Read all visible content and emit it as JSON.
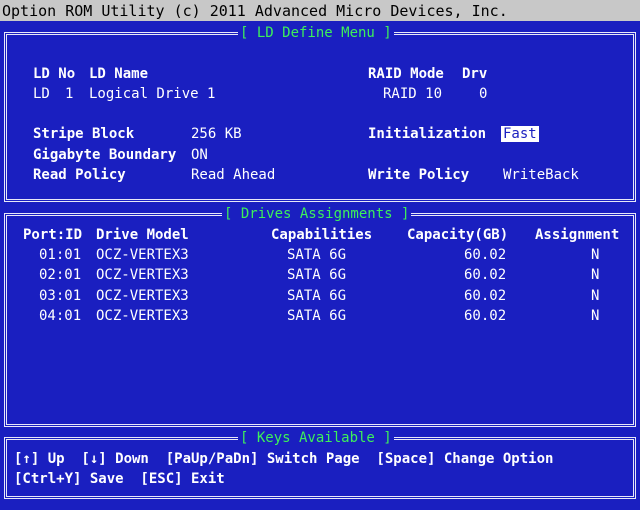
{
  "title_bar": "Option ROM Utility (c) 2011 Advanced Micro Devices, Inc.",
  "ld_menu": {
    "title": "[ LD Define Menu ]",
    "headers": {
      "ld_no": "LD No",
      "ld_name": "LD Name",
      "raid_mode": "RAID Mode",
      "drv": "Drv"
    },
    "row": {
      "ld": "LD",
      "no": "1",
      "name": "Logical Drive 1",
      "raid_mode": "RAID 10",
      "drv": "0"
    },
    "stripe_block_label": "Stripe Block",
    "stripe_block_value": "256 KB",
    "gigabyte_boundary_label": "Gigabyte Boundary",
    "gigabyte_boundary_value": "ON",
    "read_policy_label": "Read Policy",
    "read_policy_value": "Read Ahead",
    "initialization_label": "Initialization",
    "initialization_value": "Fast",
    "write_policy_label": "Write Policy",
    "write_policy_value": "WriteBack"
  },
  "drives": {
    "title": "[ Drives Assignments ]",
    "headers": {
      "port": "Port:ID",
      "model": "Drive Model",
      "caps": "Capabilities",
      "capacity": "Capacity(GB)",
      "assign": "Assignment"
    },
    "rows": [
      {
        "port": "01:01",
        "model": "OCZ-VERTEX3",
        "caps": "SATA 6G",
        "capacity": "60.02",
        "assign": "N"
      },
      {
        "port": "02:01",
        "model": "OCZ-VERTEX3",
        "caps": "SATA 6G",
        "capacity": "60.02",
        "assign": "N"
      },
      {
        "port": "03:01",
        "model": "OCZ-VERTEX3",
        "caps": "SATA 6G",
        "capacity": "60.02",
        "assign": "N"
      },
      {
        "port": "04:01",
        "model": "OCZ-VERTEX3",
        "caps": "SATA 6G",
        "capacity": "60.02",
        "assign": "N"
      }
    ]
  },
  "keys": {
    "title": "[ Keys Available ]",
    "line1": "[↑] Up  [↓] Down  [PaUp/PaDn] Switch Page  [Space] Change Option",
    "line2": "[Ctrl+Y] Save  [ESC] Exit"
  },
  "colors": {
    "background": "#1a1fc0",
    "title_green": "#3df05a",
    "title_bar": "#c8c8c8"
  }
}
